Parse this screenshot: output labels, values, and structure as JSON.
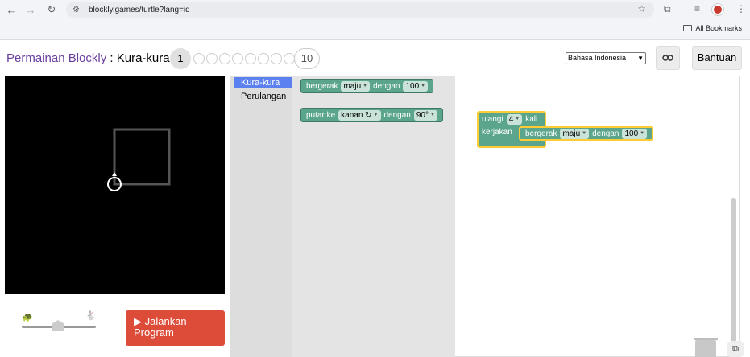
{
  "browser": {
    "url": "blockly.games/turtle?lang=id",
    "bookmarks_label": "All Bookmarks"
  },
  "header": {
    "title_link": "Permainan Blockly",
    "title_separator": " : ",
    "title_game": "Kura-kura",
    "current_level": "1",
    "last_level": "10",
    "language": "Bahasa Indonesia",
    "help_label": "Bantuan"
  },
  "toolbox": {
    "categories": [
      "Kura-kura",
      "Perulangan"
    ]
  },
  "flyout": {
    "move_block": {
      "label": "bergerak",
      "direction": "maju",
      "with": "dengan",
      "amount": "100"
    },
    "turn_block": {
      "label": "putar ke",
      "direction": "kanan ↻",
      "with": "dengan",
      "amount": "90°"
    }
  },
  "workspace": {
    "repeat_block": {
      "label": "ulangi",
      "count": "4",
      "times": "kali",
      "do": "kerjakan"
    },
    "inner_move": {
      "label": "bergerak",
      "direction": "maju",
      "with": "dengan",
      "amount": "100"
    }
  },
  "controls": {
    "run_label_1": "Jalankan",
    "run_label_2": "Program"
  }
}
